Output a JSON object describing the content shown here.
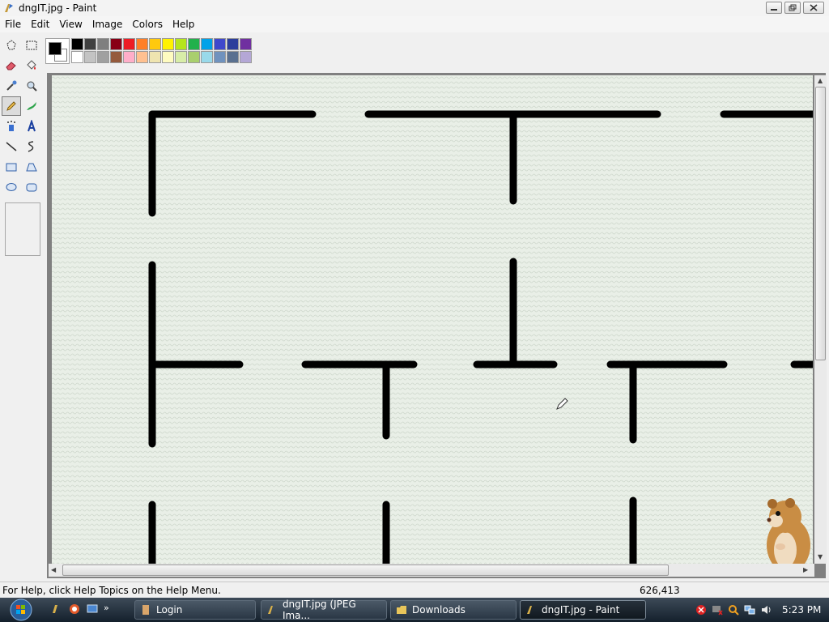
{
  "window": {
    "title": "dngIT.jpg - Paint"
  },
  "menu": [
    "File",
    "Edit",
    "View",
    "Image",
    "Colors",
    "Help"
  ],
  "tools": [
    {
      "name": "free-form-select-icon"
    },
    {
      "name": "select-icon"
    },
    {
      "name": "eraser-icon"
    },
    {
      "name": "fill-bucket-icon"
    },
    {
      "name": "color-picker-icon"
    },
    {
      "name": "magnifier-icon"
    },
    {
      "name": "pencil-icon",
      "active": true
    },
    {
      "name": "brush-icon"
    },
    {
      "name": "airbrush-icon"
    },
    {
      "name": "text-icon"
    },
    {
      "name": "line-icon"
    },
    {
      "name": "curve-icon"
    },
    {
      "name": "rectangle-icon"
    },
    {
      "name": "polygon-icon"
    },
    {
      "name": "ellipse-icon"
    },
    {
      "name": "rounded-rectangle-icon"
    }
  ],
  "palette": {
    "foreground": "#000000",
    "background": "#ffffff",
    "row1": [
      "#000000",
      "#404040",
      "#7f7f7f",
      "#880015",
      "#ed1c24",
      "#ff7f27",
      "#ffc90e",
      "#fff200",
      "#b5e61d",
      "#22b14c",
      "#00a2e8",
      "#3f48cc",
      "#2b3d9c",
      "#7030a0"
    ],
    "row2": [
      "#ffffff",
      "#c3c3c3",
      "#a0a0a0",
      "#955a3c",
      "#ffaec9",
      "#ffc090",
      "#efe4b0",
      "#fffbc0",
      "#d8eda8",
      "#a9cf6e",
      "#99d9ea",
      "#7092be",
      "#5a7090",
      "#b4a7d6"
    ]
  },
  "status": {
    "help_text": "For Help, click Help Topics on the Help Menu.",
    "coords": "626,413"
  },
  "taskbar": {
    "items": [
      {
        "label": "Login",
        "icon": "login-icon"
      },
      {
        "label": "dngIT.jpg (JPEG Ima...",
        "icon": "image-icon"
      },
      {
        "label": "Downloads",
        "icon": "folder-icon"
      },
      {
        "label": "dngIT.jpg - Paint",
        "icon": "paint-icon",
        "active": true
      }
    ],
    "clock": "5:23 PM"
  },
  "colors": {
    "canvas_bg": "#e9efe7",
    "maze_line": "#000000"
  }
}
